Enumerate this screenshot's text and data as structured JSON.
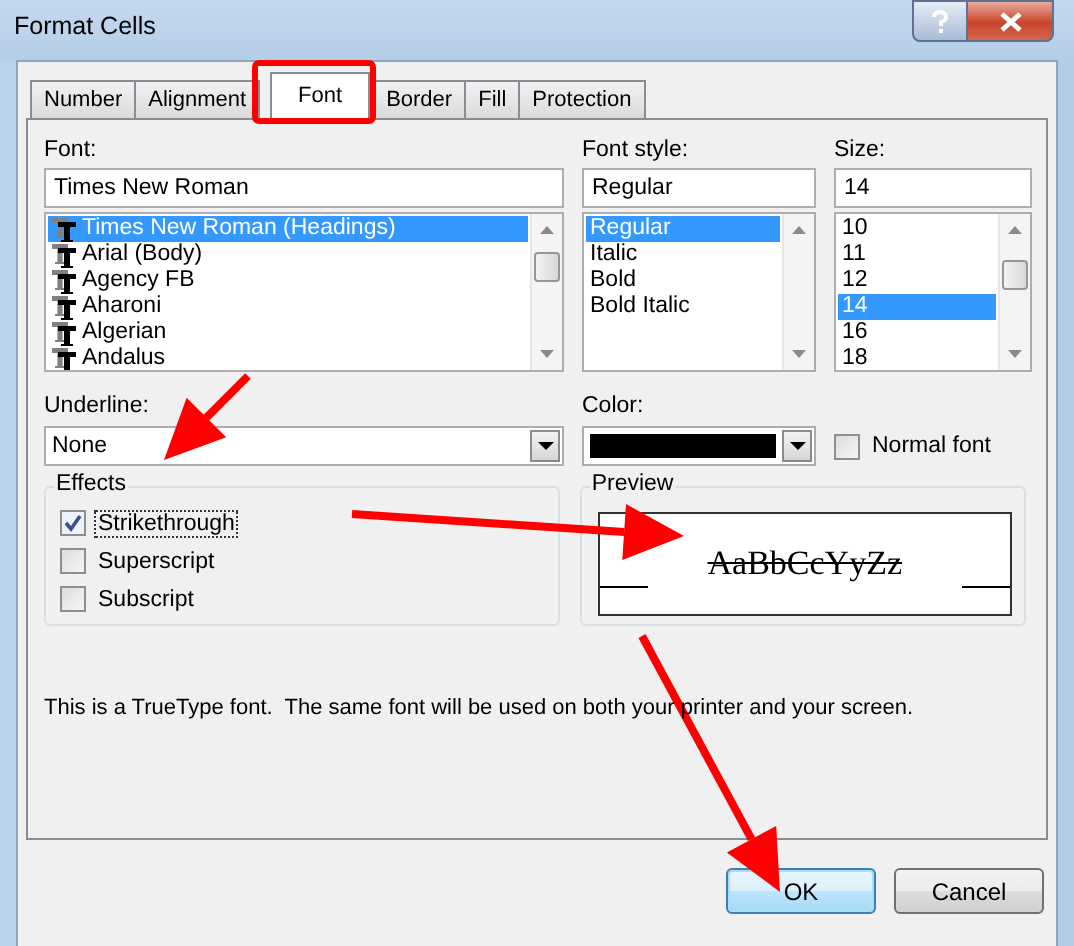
{
  "window": {
    "title": "Format Cells"
  },
  "tabs": [
    {
      "label": "Number",
      "selected": false
    },
    {
      "label": "Alignment",
      "selected": false
    },
    {
      "label": "Font",
      "selected": true
    },
    {
      "label": "Border",
      "selected": false
    },
    {
      "label": "Fill",
      "selected": false
    },
    {
      "label": "Protection",
      "selected": false
    }
  ],
  "font": {
    "label": "Font:",
    "value": "Times New Roman",
    "items": [
      {
        "label": "Times New Roman (Headings)",
        "selected": true
      },
      {
        "label": "Arial (Body)",
        "selected": false
      },
      {
        "label": "Agency FB",
        "selected": false
      },
      {
        "label": "Aharoni",
        "selected": false
      },
      {
        "label": "Algerian",
        "selected": false
      },
      {
        "label": "Andalus",
        "selected": false
      }
    ]
  },
  "font_style": {
    "label": "Font style:",
    "value": "Regular",
    "items": [
      {
        "label": "Regular",
        "selected": true
      },
      {
        "label": "Italic",
        "selected": false
      },
      {
        "label": "Bold",
        "selected": false
      },
      {
        "label": "Bold Italic",
        "selected": false
      }
    ]
  },
  "size": {
    "label": "Size:",
    "value": "14",
    "items": [
      {
        "label": "10",
        "selected": false
      },
      {
        "label": "11",
        "selected": false
      },
      {
        "label": "12",
        "selected": false
      },
      {
        "label": "14",
        "selected": true
      },
      {
        "label": "16",
        "selected": false
      },
      {
        "label": "18",
        "selected": false
      }
    ]
  },
  "underline": {
    "label": "Underline:",
    "value": "None"
  },
  "color_picker": {
    "label": "Color:",
    "color": "#000000"
  },
  "normal_font": {
    "label": "Normal font",
    "checked": false
  },
  "effects": {
    "title": "Effects",
    "options": [
      {
        "label": "Strikethrough",
        "checked": true,
        "focused": true
      },
      {
        "label": "Superscript",
        "checked": false,
        "focused": false
      },
      {
        "label": "Subscript",
        "checked": false,
        "focused": false
      }
    ]
  },
  "preview": {
    "title": "Preview",
    "sample": "AaBbCcYyZz",
    "strikethrough": true
  },
  "info": "This is a TrueType font.  The same font will be used on both your printer and your screen.",
  "buttons": [
    {
      "label": "OK",
      "default": true
    },
    {
      "label": "Cancel",
      "default": false
    }
  ],
  "annotations": [
    {
      "kind": "frame"
    },
    {
      "kind": "arrow"
    },
    {
      "kind": "arrow"
    },
    {
      "kind": "arrow"
    }
  ]
}
